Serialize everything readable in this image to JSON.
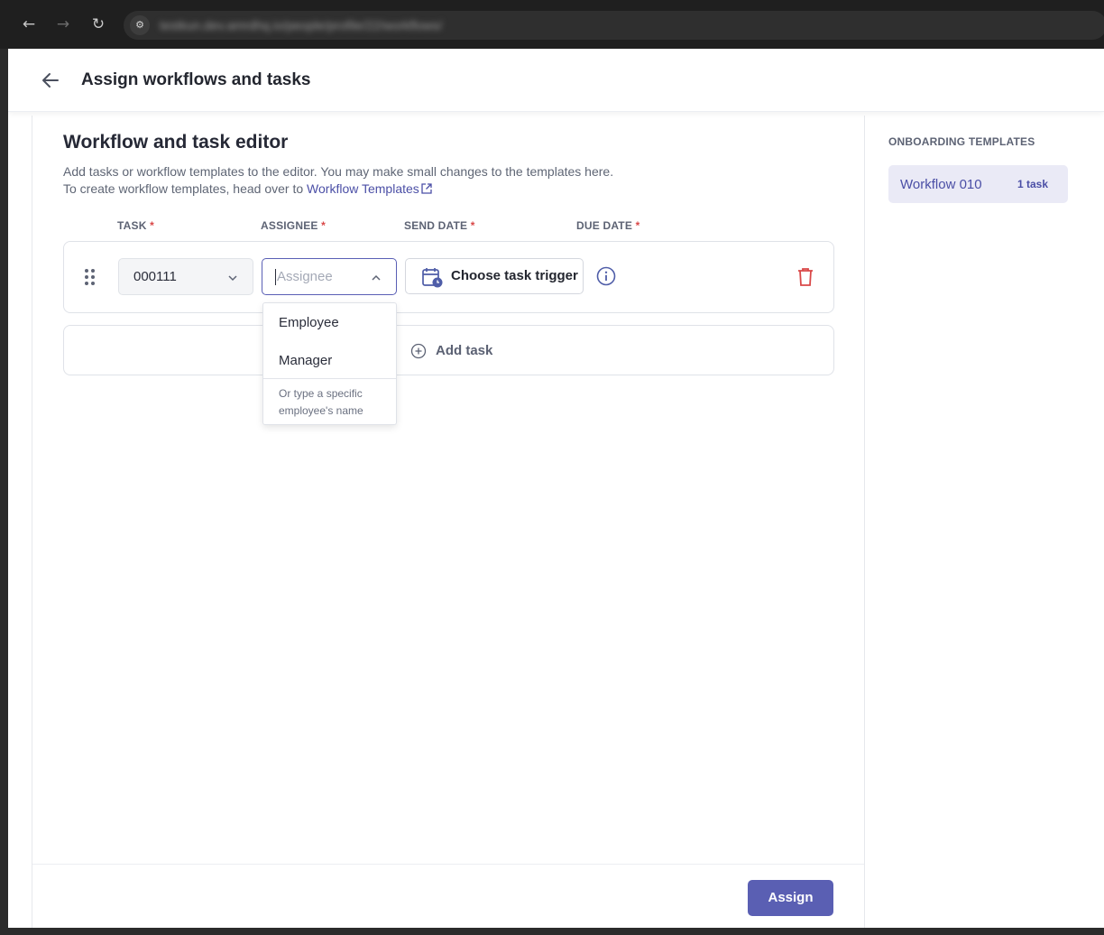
{
  "browser": {
    "url": "testkun.dev.amrdhq.io/people/profile/22/workflows/"
  },
  "header": {
    "title": "Assign workflows and tasks"
  },
  "editor": {
    "title": "Workflow and task editor",
    "description_line1": "Add tasks or workflow templates to the editor. You may make small changes to the templates here.",
    "description_line2_prefix": "To create workflow templates, head over to ",
    "templates_link": "Workflow Templates",
    "columns": {
      "task": "TASK",
      "assignee": "ASSIGNEE",
      "send_date": "SEND DATE",
      "due_date": "DUE DATE",
      "required_mark": "*"
    },
    "task_row": {
      "task_value": "000111",
      "assignee_placeholder": "Assignee",
      "trigger_label": "Choose task trigger"
    },
    "assignee_dropdown": {
      "options": [
        "Employee",
        "Manager"
      ],
      "hint": "Or type a specific employee's name"
    },
    "add_task_label": "Add task",
    "assign_label": "Assign"
  },
  "sidebar": {
    "title": "ONBOARDING TEMPLATES",
    "templates": [
      {
        "name": "Workflow 010",
        "count": "1 task"
      }
    ]
  },
  "colors": {
    "accent": "#5a5fb3",
    "link": "#4b4fa6",
    "danger": "#d94848",
    "template_bg": "#eaeaf6"
  }
}
